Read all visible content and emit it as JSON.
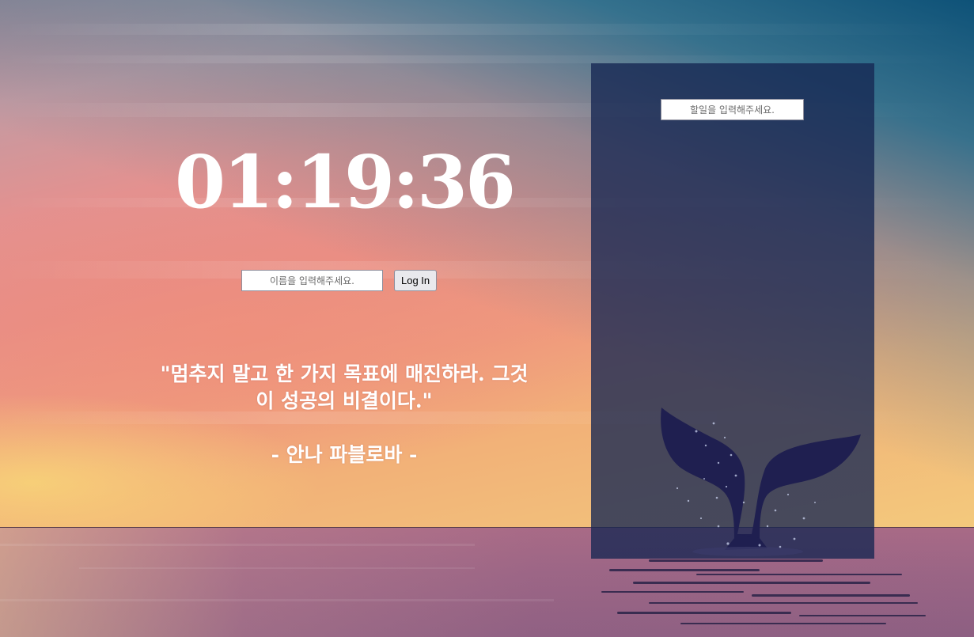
{
  "clock": {
    "time": "01:19:36"
  },
  "login": {
    "name_placeholder": "이름을 입력해주세요.",
    "button_label": "Log In"
  },
  "quote": {
    "text": "\"멈추지 말고 한 가지 목표에 매진하라. 그것이 성공의 비결이다.\"",
    "author": "- 안나 파블로바 -"
  },
  "todo": {
    "input_placeholder": "할일을 입력해주세요.",
    "items": []
  },
  "colors": {
    "panel": "#162652",
    "text": "#ffffff",
    "whale": "#1e1e4e"
  }
}
